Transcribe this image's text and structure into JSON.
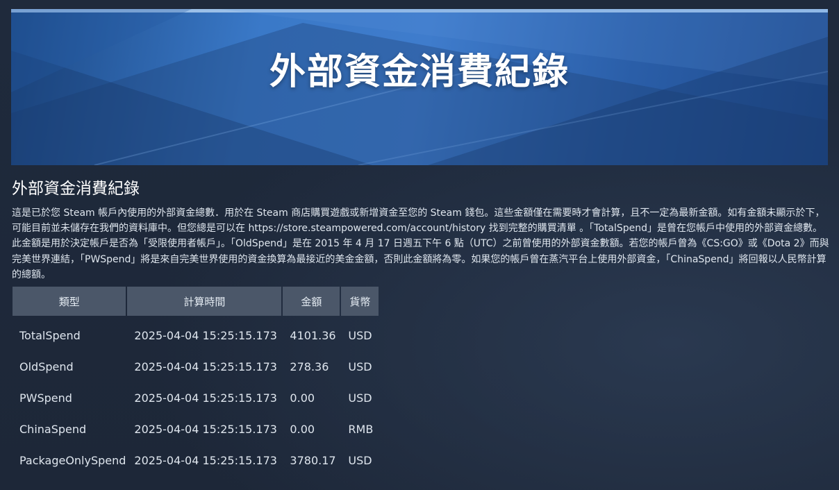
{
  "banner": {
    "title": "外部資金消費紀錄"
  },
  "section": {
    "title": "外部資金消費紀錄",
    "description": "這是已於您 Steam 帳戶內使用的外部資金總數．用於在 Steam 商店購買遊戲或新增資金至您的 Steam 錢包。這些金額僅在需要時才會計算，且不一定為最新金額。如有金額未顯示於下，可能目前並未儲存在我們的資料庫中。但您總是可以在 https://store.steampowered.com/account/history 找到完整的購買清單 。「TotalSpend」是曾在您帳戶中使用的外部資金總數。此金額是用於決定帳戶是否為「受限使用者帳戶」。「OldSpend」是在 2015 年 4 月 17 日週五下午 6 點（UTC）之前曾使用的外部資金數額。若您的帳戶曾為《CS:GO》或《Dota 2》而與完美世界連結，「PWSpend」將是來自完美世界使用的資金換算為最接近的美金金額，否則此金額將為零。如果您的帳戶曾在蒸汽平台上使用外部資金，「ChinaSpend」將回報以人民幣計算的總額。"
  },
  "table": {
    "headers": [
      "類型",
      "計算時間",
      "金額",
      "貨幣"
    ],
    "rows": [
      {
        "type": "TotalSpend",
        "time": "2025-04-04 15:25:15.173",
        "amount": "4101.36",
        "currency": "USD"
      },
      {
        "type": "OldSpend",
        "time": "2025-04-04 15:25:15.173",
        "amount": "278.36",
        "currency": "USD"
      },
      {
        "type": "PWSpend",
        "time": "2025-04-04 15:25:15.173",
        "amount": "0.00",
        "currency": "USD"
      },
      {
        "type": "ChinaSpend",
        "time": "2025-04-04 15:25:15.173",
        "amount": "0.00",
        "currency": "RMB"
      },
      {
        "type": "PackageOnlySpend",
        "time": "2025-04-04 15:25:15.173",
        "amount": "3780.17",
        "currency": "USD"
      }
    ]
  }
}
